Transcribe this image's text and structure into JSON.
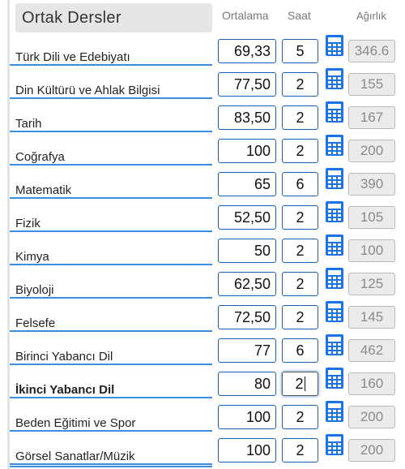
{
  "section": {
    "title": "Ortak Dersler"
  },
  "headers": {
    "average": "Ortalama",
    "hours": "Saat",
    "weight": "Ağırlık"
  },
  "colors": {
    "accent": "#3a8de0",
    "icon": "#1a73e8",
    "input_border": "#1a5fb0",
    "readonly_bg": "#ebebeb"
  },
  "icons": {
    "calculator": "calculator-icon"
  },
  "rows": [
    {
      "name": "Türk Dili ve Edebiyatı",
      "average": "69,33",
      "hours": "5",
      "weight": "346.6"
    },
    {
      "name": "Din Kültürü ve Ahlak Bilgisi",
      "average": "77,50",
      "hours": "2",
      "weight": "155"
    },
    {
      "name": "Tarih",
      "average": "83,50",
      "hours": "2",
      "weight": "167"
    },
    {
      "name": "Coğrafya",
      "average": "100",
      "hours": "2",
      "weight": "200"
    },
    {
      "name": "Matematik",
      "average": "65",
      "hours": "6",
      "weight": "390"
    },
    {
      "name": "Fizik",
      "average": "52,50",
      "hours": "2",
      "weight": "105"
    },
    {
      "name": "Kimya",
      "average": "50",
      "hours": "2",
      "weight": "100"
    },
    {
      "name": "Biyoloji",
      "average": "62,50",
      "hours": "2",
      "weight": "125"
    },
    {
      "name": "Felsefe",
      "average": "72,50",
      "hours": "2",
      "weight": "145"
    },
    {
      "name": "Birinci Yabancı Dil",
      "average": "77",
      "hours": "6",
      "weight": "462"
    },
    {
      "name": "İkinci Yabancı Dil",
      "average": "80",
      "hours": "2",
      "weight": "160"
    },
    {
      "name": "Beden Eğitimi ve Spor",
      "average": "100",
      "hours": "2",
      "weight": "200"
    },
    {
      "name": "Görsel Sanatlar/Müzik",
      "average": "100",
      "hours": "2",
      "weight": "200"
    }
  ]
}
